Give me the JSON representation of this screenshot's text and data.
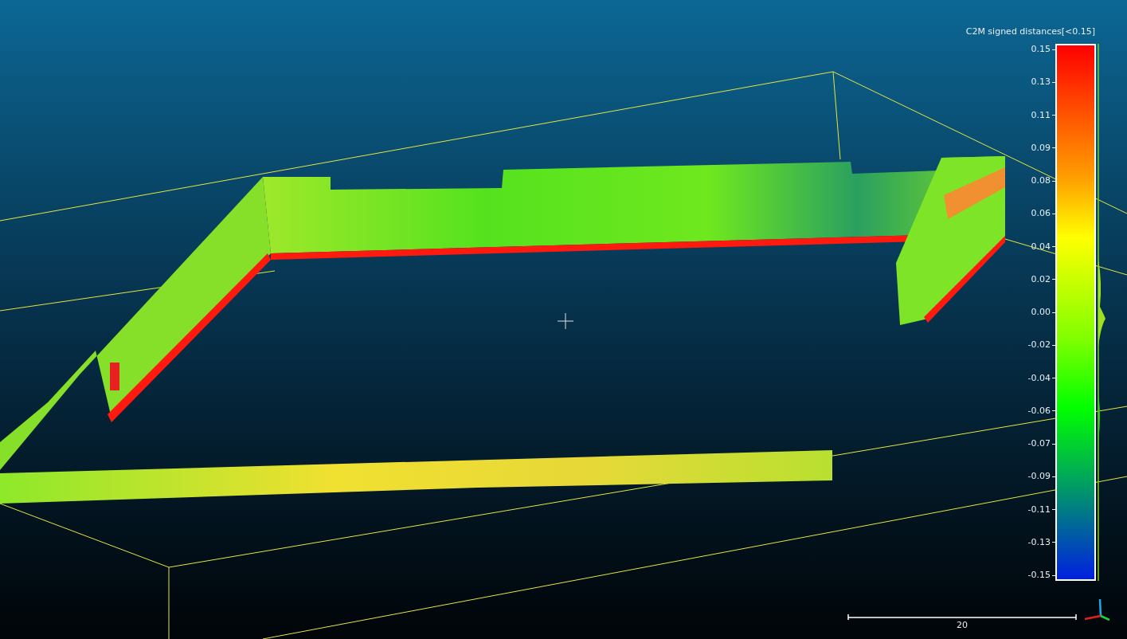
{
  "color_scale": {
    "title": "C2M signed distances[<0.15]",
    "ticks": [
      "0.15",
      "0.13",
      "0.11",
      "0.09",
      "0.08",
      "0.06",
      "0.04",
      "0.02",
      "0.00",
      "-0.02",
      "-0.04",
      "-0.06",
      "-0.07",
      "-0.09",
      "-0.11",
      "-0.13",
      "-0.15"
    ]
  },
  "scale_bar": {
    "label": "20"
  }
}
